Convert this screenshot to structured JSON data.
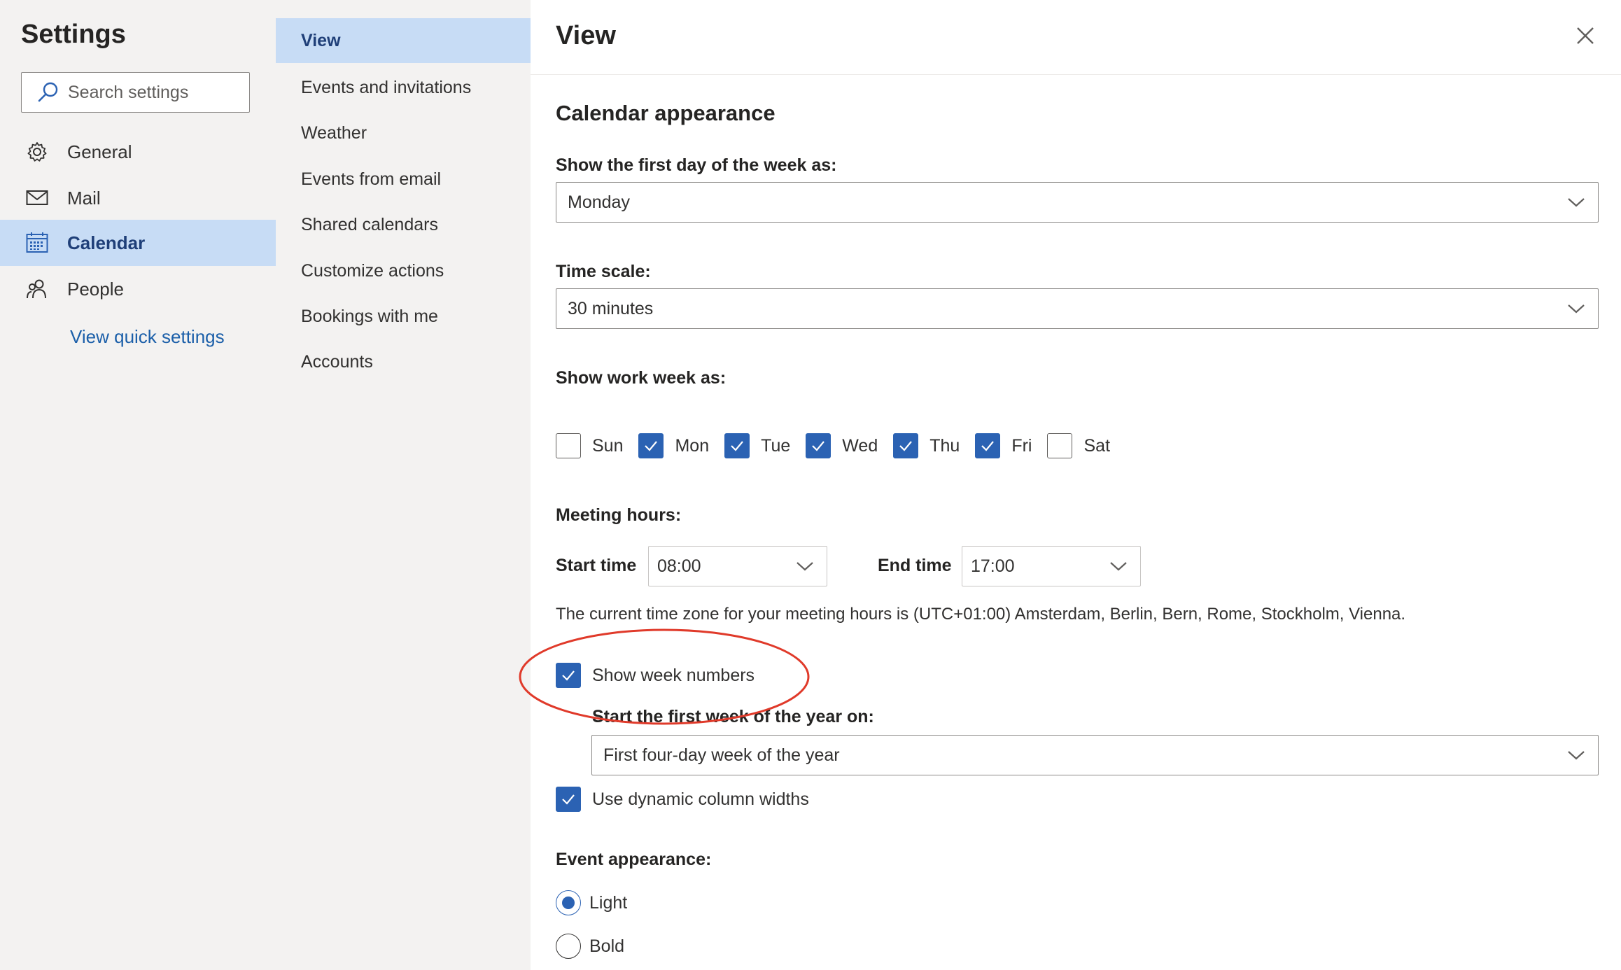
{
  "settings_nav": {
    "title": "Settings",
    "search_placeholder": "Search settings",
    "items": [
      {
        "label": "General",
        "icon": "gear-icon"
      },
      {
        "label": "Mail",
        "icon": "mail-icon"
      },
      {
        "label": "Calendar",
        "icon": "calendar-icon",
        "selected": true
      },
      {
        "label": "People",
        "icon": "people-icon"
      }
    ],
    "quick_settings_link": "View quick settings"
  },
  "calendar_nav": {
    "items": [
      {
        "label": "View",
        "selected": true
      },
      {
        "label": "Events and invitations"
      },
      {
        "label": "Weather"
      },
      {
        "label": "Events from email"
      },
      {
        "label": "Shared calendars"
      },
      {
        "label": "Customize actions"
      },
      {
        "label": "Bookings with me"
      },
      {
        "label": "Accounts"
      }
    ]
  },
  "panel": {
    "title": "View",
    "section_title": "Calendar appearance",
    "first_day": {
      "label": "Show the first day of the week as:",
      "value": "Monday"
    },
    "time_scale": {
      "label": "Time scale:",
      "value": "30 minutes"
    },
    "work_week": {
      "label": "Show work week as:",
      "days": [
        {
          "label": "Sun",
          "checked": false
        },
        {
          "label": "Mon",
          "checked": true
        },
        {
          "label": "Tue",
          "checked": true
        },
        {
          "label": "Wed",
          "checked": true
        },
        {
          "label": "Thu",
          "checked": true
        },
        {
          "label": "Fri",
          "checked": true
        },
        {
          "label": "Sat",
          "checked": false
        }
      ]
    },
    "meeting_hours": {
      "label": "Meeting hours:",
      "start_label": "Start time",
      "start_value": "08:00",
      "end_label": "End time",
      "end_value": "17:00",
      "timezone_note": "The current time zone for your meeting hours is (UTC+01:00) Amsterdam, Berlin, Bern, Rome, Stockholm, Vienna."
    },
    "week_numbers": {
      "label": "Show week numbers",
      "checked": true
    },
    "first_week": {
      "label": "Start the first week of the year on:",
      "value": "First four-day week of the year"
    },
    "dynamic_widths": {
      "label": "Use dynamic column widths",
      "checked": true
    },
    "event_appearance": {
      "label": "Event appearance:",
      "options": [
        {
          "label": "Light",
          "checked": true
        },
        {
          "label": "Bold",
          "checked": false
        }
      ]
    }
  },
  "colors": {
    "accent": "#2b62b3",
    "selected_bg": "#c7dcf5",
    "link": "#1b5fa9",
    "annotation": "#e03a2a"
  }
}
